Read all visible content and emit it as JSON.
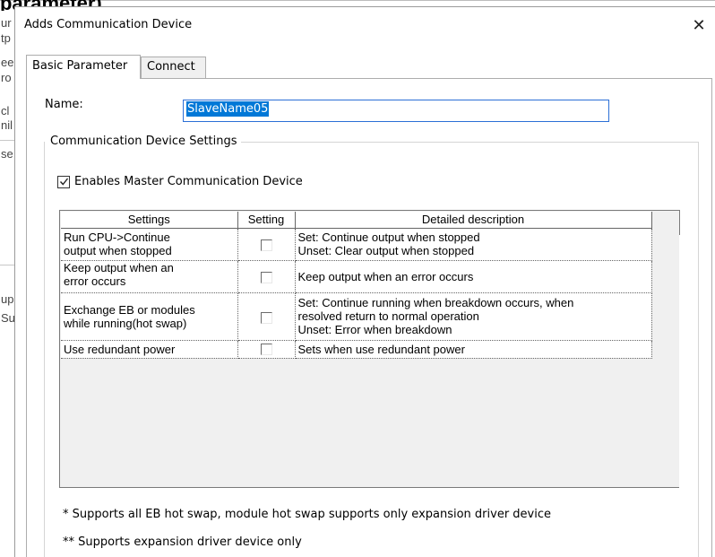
{
  "background": {
    "top_text": "parameter).",
    "fragments": [
      "ur",
      "tp",
      "ee",
      "ro",
      "cl",
      "nil",
      "se",
      "up",
      "Su"
    ]
  },
  "dialog": {
    "title": "Adds Communication Device",
    "close_icon": "close-icon"
  },
  "tabs": [
    {
      "label": "Basic Parameter",
      "active": true
    },
    {
      "label": "Connect",
      "active": false
    }
  ],
  "basic": {
    "name_label": "Name:",
    "name_value": "SlaveName05",
    "group_title": "Communication Device Settings",
    "master_checkbox": {
      "label": "Enables Master Communication Device",
      "checked": true
    },
    "table": {
      "headers": [
        "Settings",
        "Setting",
        "Detailed description"
      ],
      "rows": [
        {
          "settings": [
            "Run CPU->Continue",
            "output when stopped"
          ],
          "checked": false,
          "description": [
            "Set: Continue output when stopped",
            "Unset: Clear output when stopped"
          ]
        },
        {
          "settings": [
            "Keep output when an",
            "error occurs"
          ],
          "checked": false,
          "description": [
            "Keep output when an error occurs"
          ]
        },
        {
          "settings": [
            "Exchange EB or modules",
            "while running(hot swap)"
          ],
          "checked": false,
          "description": [
            "Set: Continue running when breakdown occurs, when",
            "resolved return to normal operation",
            "Unset: Error when breakdown"
          ]
        },
        {
          "settings": [
            "Use redundant power"
          ],
          "checked": false,
          "description": [
            "Sets when use redundant power"
          ]
        }
      ]
    },
    "notes": [
      "* Supports all EB hot swap, module hot swap supports only expansion driver device",
      "** Supports expansion driver device only"
    ]
  },
  "colors": {
    "selection": "#0078d7",
    "input_focus_border": "#2c6fd6",
    "grid_background": "#f0f0f0"
  }
}
